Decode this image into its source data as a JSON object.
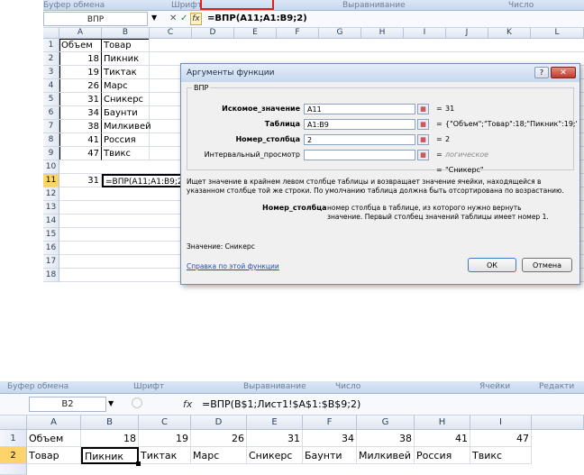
{
  "top": {
    "ribbon": [
      "Буфер обмена",
      "Шрифт",
      "Выравнивание",
      "Число"
    ],
    "name_box": "ВПР",
    "fx": "fx",
    "cancel": "✕",
    "enter": "✓",
    "formula": "=ВПР(A11;A1:B9;2)",
    "columns": [
      "A",
      "B",
      "C",
      "D",
      "E",
      "F",
      "G",
      "H",
      "I",
      "J",
      "K",
      "L"
    ],
    "rows": [
      "1",
      "2",
      "3",
      "4",
      "5",
      "6",
      "7",
      "8",
      "9",
      "10",
      "11",
      "12",
      "13",
      "14",
      "15",
      "16",
      "17",
      "18"
    ],
    "table": [
      [
        "Объем",
        "Товар"
      ],
      [
        "18",
        "Пикник"
      ],
      [
        "19",
        "Тиктак"
      ],
      [
        "26",
        "Марс"
      ],
      [
        "31",
        "Сникерс"
      ],
      [
        "34",
        "Баунти"
      ],
      [
        "38",
        "Милкивей"
      ],
      [
        "41",
        "Россия"
      ],
      [
        "47",
        "Твикс"
      ]
    ],
    "a11": "31",
    "b11": "=ВПР(A11;A1:B9;2)",
    "dialog": {
      "title": "Аргументы функции",
      "help_icon": "?",
      "close_icon": "✕",
      "func": "ВПР",
      "args": [
        {
          "label": "Искомое_значение",
          "value": "A11",
          "result": "31"
        },
        {
          "label": "Таблица",
          "value": "A1:B9",
          "result": "{\"Объем\";\"Товар\":18;\"Пикник\":19;\"Т"
        },
        {
          "label": "Номер_столбца",
          "value": "2",
          "result": "2"
        },
        {
          "label": "Интервальный_просмотр",
          "value": "",
          "result": "логическое"
        }
      ],
      "eq": "=",
      "total": "\"Сникерс\"",
      "desc": "Ищет значение в крайнем левом столбце таблицы и возвращает значение ячейки, находящейся в указанном столбце той же строки. По умолчанию таблица должна быть отсортирована по возрастанию.",
      "arg_name": "Номер_столбца",
      "arg_desc": "номер столбца в таблице, из которого нужно вернуть значение. Первый столбец значений таблицы имеет номер 1.",
      "value_line": "Значение:  Сникерс",
      "help_link": "Справка по этой функции",
      "ok": "ОК",
      "cancel": "Отмена"
    }
  },
  "bottom": {
    "ribbon": [
      "Буфер обмена",
      "Шрифт",
      "Выравнивание",
      "Число",
      "Ячейки",
      "Редакти"
    ],
    "name_box": "B2",
    "fx": "fx",
    "formula": "=ВПР(B$1;Лист1!$A$1:$B$9;2)",
    "columns": [
      "A",
      "B",
      "C",
      "D",
      "E",
      "F",
      "G",
      "H",
      "I"
    ],
    "rows": [
      "1",
      "2"
    ],
    "row1": [
      "Объем",
      "18",
      "19",
      "26",
      "31",
      "34",
      "38",
      "41",
      "47"
    ],
    "row2": [
      "Товар",
      "Пикник",
      "Тиктак",
      "Марс",
      "Сникерс",
      "Баунти",
      "Милкивей",
      "Россия",
      "Твикс"
    ]
  }
}
